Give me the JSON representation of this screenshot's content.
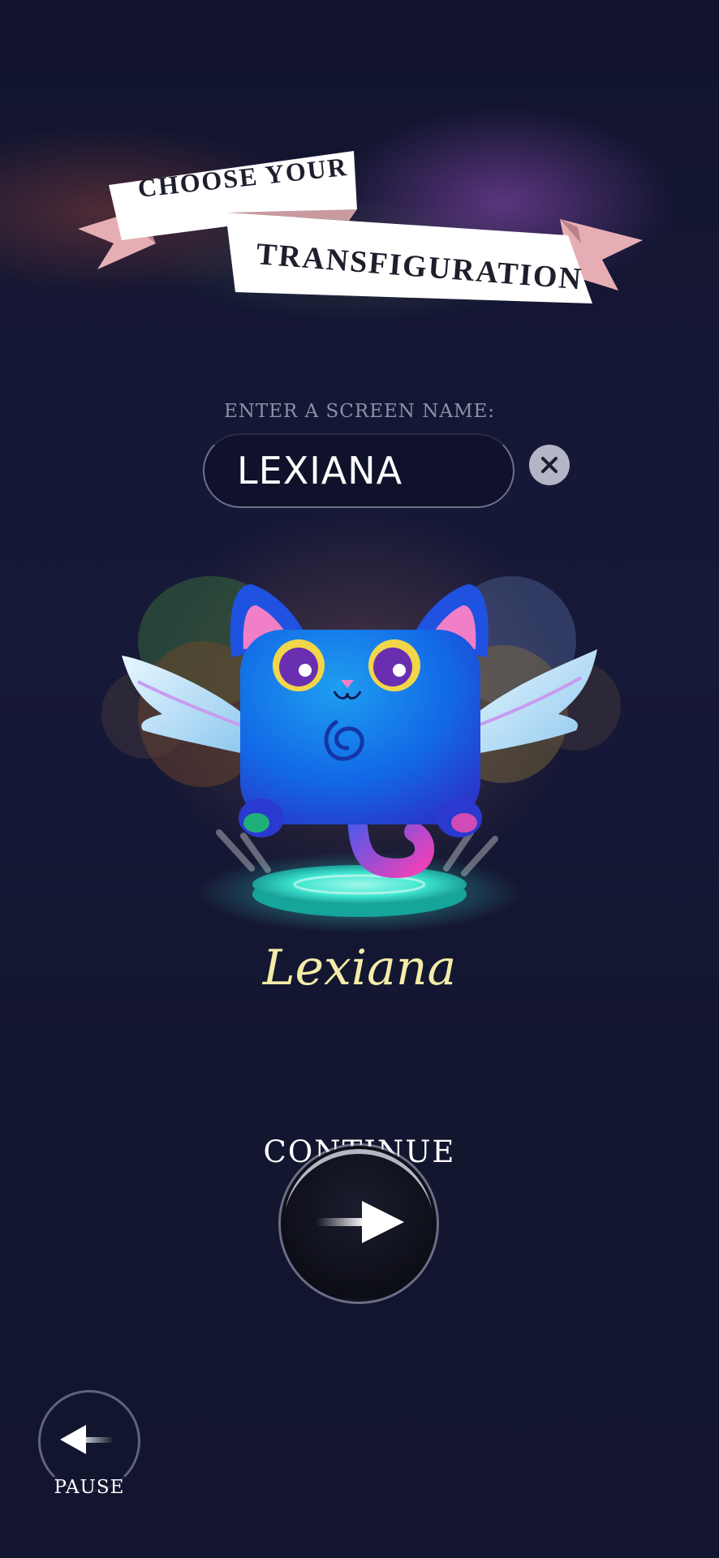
{
  "banner": {
    "line1": "CHOOSE YOUR",
    "line2": "TRANSFIGURATION"
  },
  "name_entry": {
    "label": "ENTER A SCREEN NAME:",
    "value": "LEXIANA"
  },
  "character": {
    "name": "Lexiana"
  },
  "continue": {
    "label": "CONTINUE"
  },
  "pause": {
    "label": "PAUSE"
  },
  "icons": {
    "clear": "close-x-icon",
    "continue": "arrow-right-icon",
    "pause": "arrow-left-icon"
  },
  "colors": {
    "background": "#141633",
    "character_name": "#f4eca8",
    "banner_ribbon": "#e9b4b8",
    "pedestal_glow": "#3fe6cf"
  }
}
